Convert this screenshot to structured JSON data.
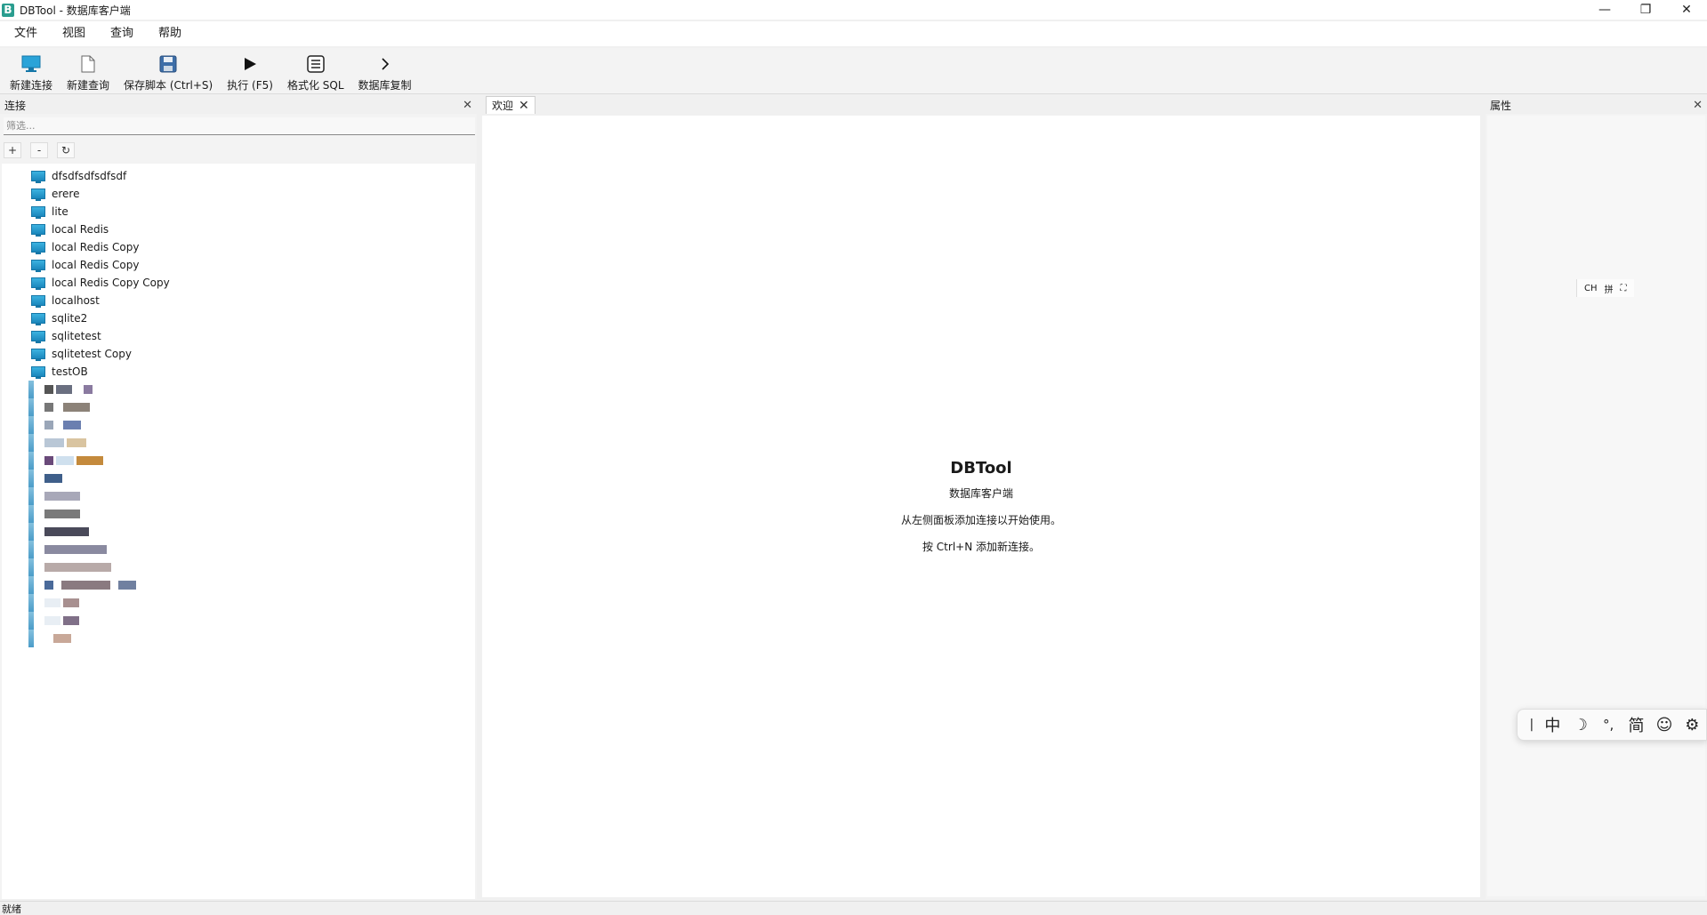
{
  "window": {
    "title": "DBTool - 数据库客户端",
    "logo": "B",
    "minimize": "—",
    "maximize": "❐",
    "close": "✕"
  },
  "menu": [
    "文件",
    "视图",
    "查询",
    "帮助"
  ],
  "toolbar": [
    {
      "label": "新建连接",
      "icon": "monitor-icon"
    },
    {
      "label": "新建查询",
      "icon": "document-icon"
    },
    {
      "label": "保存脚本 (Ctrl+S)",
      "icon": "save-icon"
    },
    {
      "label": "执行 (F5)",
      "icon": "play-icon"
    },
    {
      "label": "格式化 SQL",
      "icon": "format-icon"
    },
    {
      "label": "数据库复制",
      "icon": "chevron-right-icon"
    }
  ],
  "connections_panel": {
    "title": "连接",
    "close": "✕",
    "filter_placeholder": "筛选...",
    "tools": [
      "+",
      "-",
      "↻"
    ],
    "items": [
      "dfsdfsdfsdfsdf",
      "erere",
      "lite",
      "local Redis",
      "local Redis Copy",
      "local Redis Copy",
      "local Redis Copy Copy",
      "localhost",
      "sqlite2",
      "sqlitetest",
      "sqlitetest Copy",
      "testOB"
    ]
  },
  "center": {
    "tab_label": "欢迎",
    "tab_close": "✕",
    "welcome_title": "DBTool",
    "welcome_lines": [
      "数据库客户端",
      "从左侧面板添加连接以开始使用。",
      "按 Ctrl+N 添加新连接。"
    ]
  },
  "properties_panel": {
    "title": "属性",
    "close": "✕"
  },
  "ime_mini": [
    "CH",
    "拼",
    "⛶"
  ],
  "ime_bar": [
    "|",
    "中",
    "☽",
    "°,",
    "简",
    "☺",
    "⚙"
  ],
  "status": {
    "text": "就绪"
  },
  "colors": {
    "accent": "#1b88bd",
    "tab_bg": "#ffffff"
  }
}
